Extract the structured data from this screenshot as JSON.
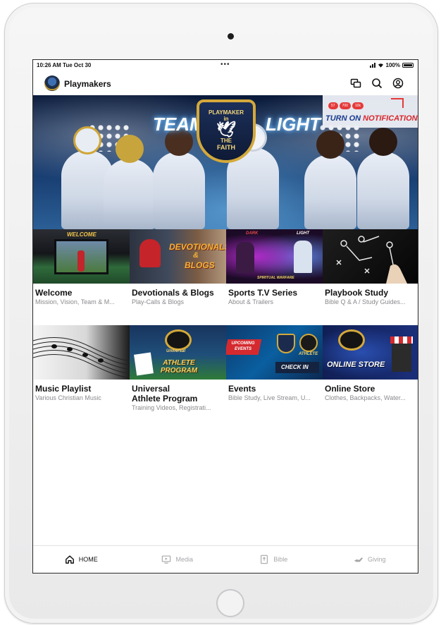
{
  "status_bar": {
    "time_date": "10:26 AM  Tue Oct 30",
    "dots": "•••",
    "battery": "100%"
  },
  "app_bar": {
    "title": "Playmakers",
    "icons": [
      "chat-icon",
      "search-icon",
      "account-icon"
    ]
  },
  "hero": {
    "left_text": "TEAM",
    "right_text": "LIGHT",
    "crest_top": "PLAYMAKER",
    "crest_in": "in",
    "crest_the": "THE",
    "crest_bottom": "FAITH",
    "notification_cta_a": "TURN ON",
    "notification_cta_b": "NOTIFICATIONS",
    "notification_pills": [
      "57",
      "700",
      "10k"
    ]
  },
  "tiles": [
    {
      "title": "Welcome",
      "subtitle": "Mission, Vision, Team & M...",
      "image_label": "WELCOME"
    },
    {
      "title": "Devotionals & Blogs",
      "subtitle": "Play-Calls & Blogs",
      "image_label_a": "DEVOTIONALS",
      "image_label_b": "&",
      "image_label_c": "BLOGS"
    },
    {
      "title": "Sports T.V Series",
      "subtitle": "About & Trailers",
      "image_label_a": "DARK",
      "image_label_b": "LIGHT",
      "image_label_c": "SPIRITUAL WARFARE"
    },
    {
      "title": "Playbook Study",
      "subtitle": "Bible Q & A / Study Guides..."
    },
    {
      "title": "Music Playlist",
      "subtitle": "Various Christian Music"
    },
    {
      "title": "Universal Athlete Program",
      "title_line1": "Universal",
      "title_line2": "Athlete Program",
      "subtitle": "Training Videos, Registrati...",
      "image_label": "ATHLETE PROGRAM",
      "image_small": "Universal"
    },
    {
      "title": "Events",
      "subtitle": "Bible Study, Live Stream, U...",
      "image_label_a": "UPCOMING EVENTS",
      "image_label_b": "ATHLETE",
      "image_label_c": "CHECK IN"
    },
    {
      "title": "Online Store",
      "subtitle": "Clothes, Backpacks, Water...",
      "image_label": "ONLINE STORE"
    }
  ],
  "tabs": [
    {
      "label": "HOME",
      "icon": "home-icon",
      "active": true
    },
    {
      "label": "Media",
      "icon": "media-icon",
      "active": false
    },
    {
      "label": "Bible",
      "icon": "bible-icon",
      "active": false
    },
    {
      "label": "Giving",
      "icon": "giving-icon",
      "active": false
    }
  ],
  "colors": {
    "accent_red": "#d9262c",
    "accent_blue": "#1a3b8f",
    "gold": "#d4a93a",
    "tab_inactive": "#a7a7aa"
  }
}
